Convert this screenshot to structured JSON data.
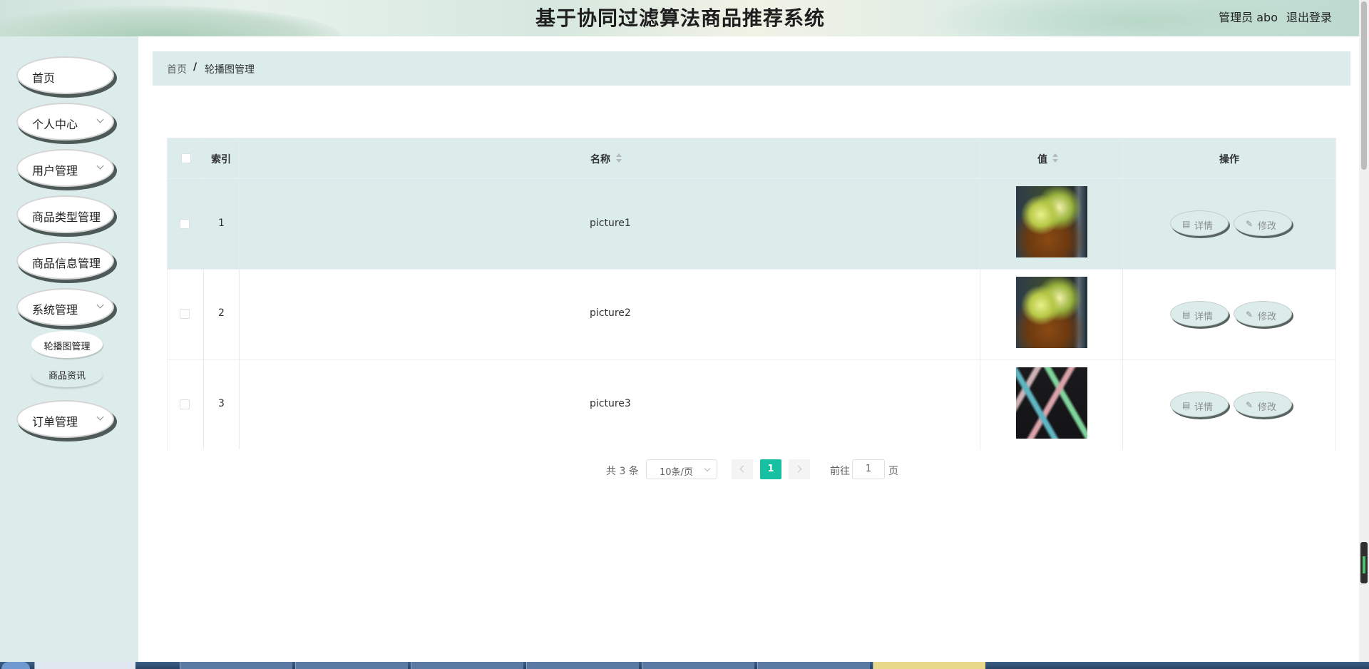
{
  "header": {
    "title": "基于协同过滤算法商品推荐系统",
    "user_label": "管理员 abo",
    "logout_label": "退出登录"
  },
  "sidebar": {
    "items": [
      {
        "label": "首页",
        "has_arrow": false
      },
      {
        "label": "个人中心",
        "has_arrow": true
      },
      {
        "label": "用户管理",
        "has_arrow": true
      },
      {
        "label": "商品类型管理",
        "has_arrow": false
      },
      {
        "label": "商品信息管理",
        "has_arrow": false
      },
      {
        "label": "系统管理",
        "has_arrow": true
      },
      {
        "label": "订单管理",
        "has_arrow": true
      }
    ],
    "sub_items": [
      {
        "label": "轮播图管理",
        "active": true
      },
      {
        "label": "商品资讯",
        "active": false
      }
    ]
  },
  "breadcrumb": {
    "home": "首页",
    "separator": "/",
    "current": "轮播图管理"
  },
  "table": {
    "columns": [
      "索引",
      "名称",
      "值",
      "操作"
    ],
    "rows": [
      {
        "index": "1",
        "name": "picture1",
        "image": "food-photo",
        "highlighted": true
      },
      {
        "index": "2",
        "name": "picture2",
        "image": "food-photo",
        "highlighted": false
      },
      {
        "index": "3",
        "name": "picture3",
        "image": "shoe-photo",
        "highlighted": false
      }
    ],
    "actions": {
      "detail_label": "详情",
      "detail_icon": "document-icon",
      "edit_label": "修改",
      "edit_icon": "pencil-icon"
    }
  },
  "pagination": {
    "total": "共 3 条",
    "page_size": "10条/页",
    "current_page": "1",
    "goto_label": "前往",
    "goto_value": "1",
    "page_unit": "页"
  },
  "colors": {
    "accent": "#16c0a0",
    "panel": "#dbeceb",
    "text": "#303133"
  }
}
